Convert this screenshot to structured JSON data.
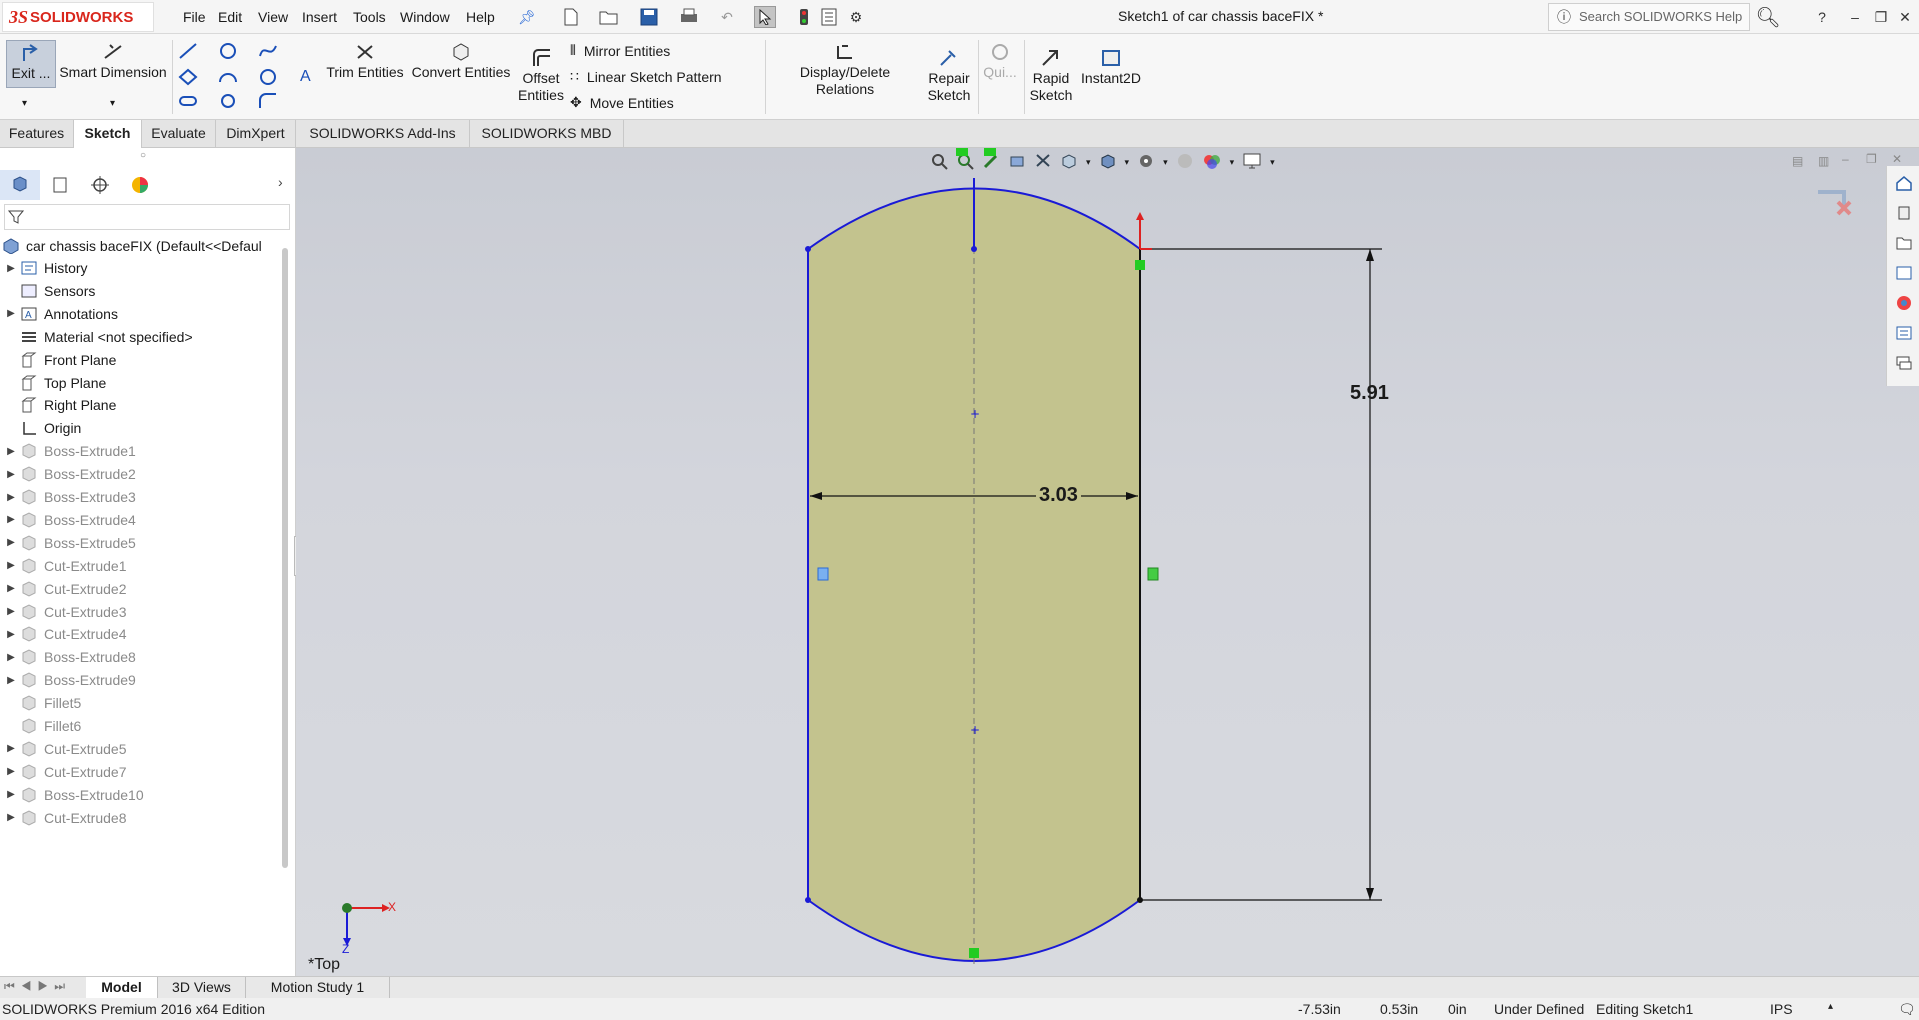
{
  "app": {
    "logo_ds": "3S",
    "logo_text": "SOLIDWORKS",
    "window_title": "Sketch1 of car chassis baceFIX *",
    "search_placeholder": "Search SOLIDWORKS Help"
  },
  "menu": [
    "File",
    "Edit",
    "View",
    "Insert",
    "Tools",
    "Window",
    "Help"
  ],
  "title_controls": {
    "help": "?",
    "minimize": "–",
    "restore": "❐",
    "close": "✕"
  },
  "commands": {
    "exit": "Exit ...",
    "smart_dimension": "Smart Dimension",
    "trim_entities": "Trim Entities",
    "convert_entities": "Convert Entities",
    "offset_entities_1": "Offset",
    "offset_entities_2": "Entities",
    "mirror_entities": "Mirror Entities",
    "linear_sketch_pattern": "Linear Sketch Pattern",
    "move_entities": "Move Entities",
    "display_delete_relations": "Display/Delete Relations",
    "repair_sketch_1": "Repair",
    "repair_sketch_2": "Sketch",
    "quick_snaps": "Qui...",
    "rapid_sketch_1": "Rapid",
    "rapid_sketch_2": "Sketch",
    "instant2d": "Instant2D"
  },
  "tabs": [
    "Features",
    "Sketch",
    "Evaluate",
    "DimXpert",
    "SOLIDWORKS Add-Ins",
    "SOLIDWORKS MBD"
  ],
  "active_tab": "Sketch",
  "tree": {
    "root": "car chassis baceFIX  (Default<<Defaul",
    "items": [
      {
        "label": "History",
        "expand": true,
        "dim": false
      },
      {
        "label": "Sensors",
        "expand": false,
        "dim": false
      },
      {
        "label": "Annotations",
        "expand": true,
        "dim": false
      },
      {
        "label": "Material <not specified>",
        "expand": false,
        "dim": false
      },
      {
        "label": "Front Plane",
        "expand": false,
        "dim": false
      },
      {
        "label": "Top Plane",
        "expand": false,
        "dim": false
      },
      {
        "label": "Right Plane",
        "expand": false,
        "dim": false
      },
      {
        "label": "Origin",
        "expand": false,
        "dim": false
      },
      {
        "label": "Boss-Extrude1",
        "expand": true,
        "dim": true
      },
      {
        "label": "Boss-Extrude2",
        "expand": true,
        "dim": true
      },
      {
        "label": "Boss-Extrude3",
        "expand": true,
        "dim": true
      },
      {
        "label": "Boss-Extrude4",
        "expand": true,
        "dim": true
      },
      {
        "label": "Boss-Extrude5",
        "expand": true,
        "dim": true
      },
      {
        "label": "Cut-Extrude1",
        "expand": true,
        "dim": true
      },
      {
        "label": "Cut-Extrude2",
        "expand": true,
        "dim": true
      },
      {
        "label": "Cut-Extrude3",
        "expand": true,
        "dim": true
      },
      {
        "label": "Cut-Extrude4",
        "expand": true,
        "dim": true
      },
      {
        "label": "Boss-Extrude8",
        "expand": true,
        "dim": true
      },
      {
        "label": "Boss-Extrude9",
        "expand": true,
        "dim": true
      },
      {
        "label": "Fillet5",
        "expand": false,
        "dim": true
      },
      {
        "label": "Fillet6",
        "expand": false,
        "dim": true
      },
      {
        "label": "Cut-Extrude5",
        "expand": true,
        "dim": true
      },
      {
        "label": "Cut-Extrude7",
        "expand": true,
        "dim": true
      },
      {
        "label": "Boss-Extrude10",
        "expand": true,
        "dim": true
      },
      {
        "label": "Cut-Extrude8",
        "expand": true,
        "dim": true
      }
    ]
  },
  "viewport": {
    "dimension_width": "3.03",
    "dimension_height": "5.91",
    "view_label": "*Top",
    "axis_x": "X",
    "axis_z": "Z"
  },
  "bottom_tabs": [
    "Model",
    "3D Views",
    "Motion Study 1"
  ],
  "status": {
    "edition": "SOLIDWORKS Premium 2016 x64 Edition",
    "x": "-7.53in",
    "y": "0.53in",
    "z": "0in",
    "definition": "Under Defined",
    "editing": "Editing Sketch1",
    "units": "IPS"
  },
  "colors": {
    "sketch_fill": "#c3c38e",
    "sketch_line": "#1a1ad6",
    "brand_red": "#d9261c"
  }
}
